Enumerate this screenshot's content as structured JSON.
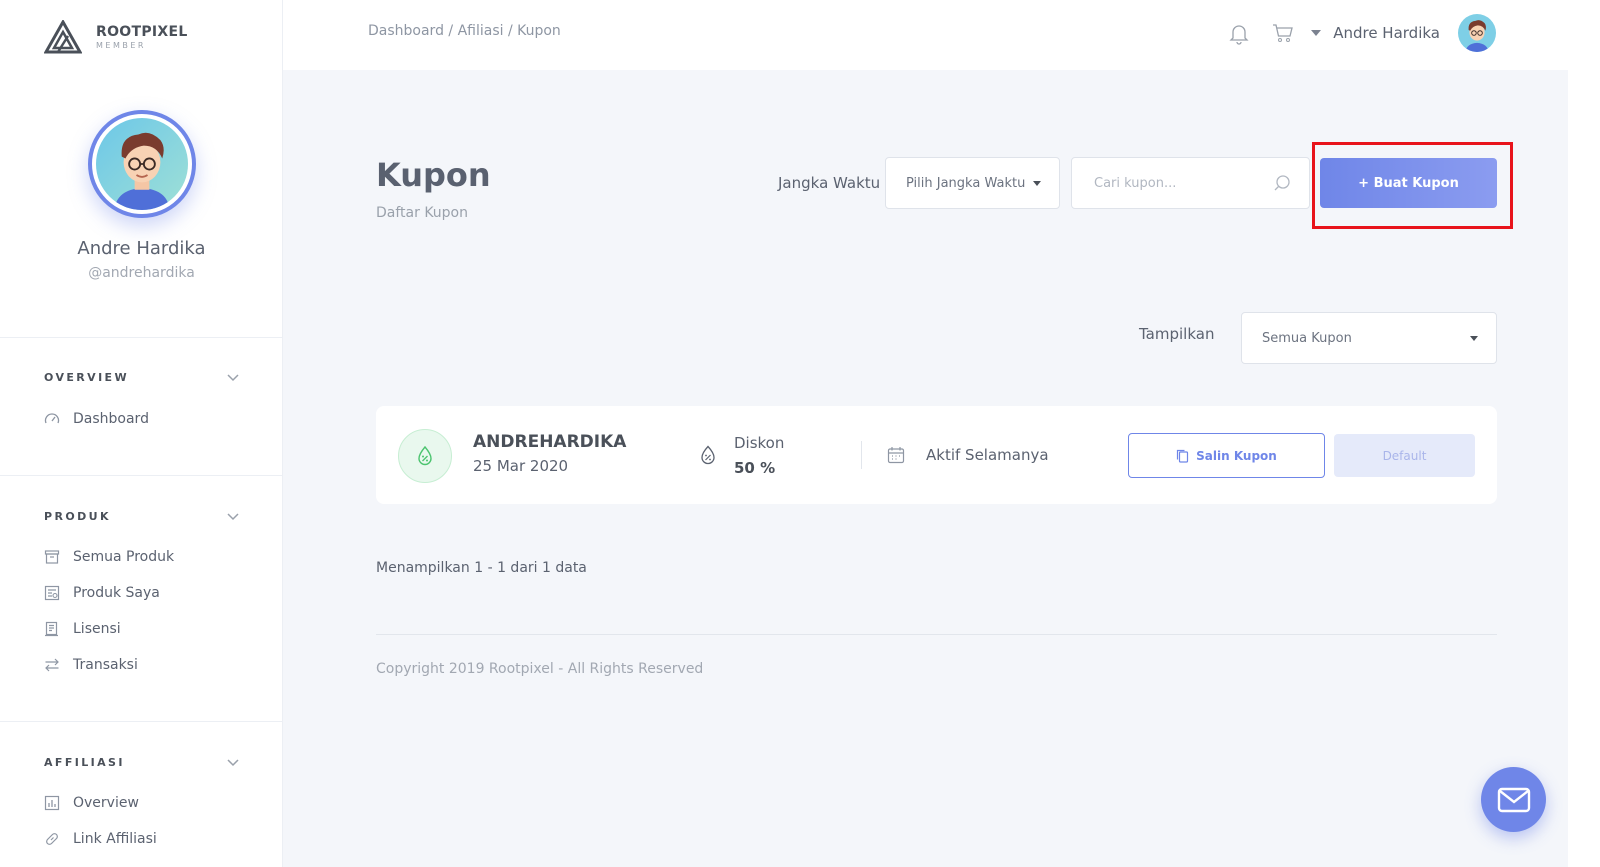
{
  "brand": {
    "name": "ROOTPIXEL",
    "sub": "MEMBER"
  },
  "profile": {
    "name": "Andre Hardika",
    "handle": "@andrehardika"
  },
  "sidebar": {
    "overview": {
      "title": "OVERVIEW",
      "items": [
        {
          "label": "Dashboard",
          "icon": "speedometer-icon"
        }
      ]
    },
    "produk": {
      "title": "PRODUK",
      "items": [
        {
          "label": "Semua Produk",
          "icon": "box-icon"
        },
        {
          "label": "Produk Saya",
          "icon": "product-list-icon"
        },
        {
          "label": "Lisensi",
          "icon": "license-icon"
        },
        {
          "label": "Transaksi",
          "icon": "transfer-icon"
        }
      ]
    },
    "affiliasi": {
      "title": "AFFILIASI",
      "items": [
        {
          "label": "Overview",
          "icon": "bar-chart-icon"
        },
        {
          "label": "Link Affiliasi",
          "icon": "link-icon"
        }
      ]
    }
  },
  "topbar": {
    "breadcrumb": "Dashboard / Afiliasi / Kupon",
    "user_name": "Andre Hardika"
  },
  "page": {
    "title": "Kupon",
    "subtitle": "Daftar Kupon"
  },
  "filters": {
    "period_label": "Jangka Waktu",
    "period_value": "Pilih Jangka Waktu",
    "search_placeholder": "Cari kupon...",
    "create_button": "+ Buat Kupon",
    "show_label": "Tampilkan",
    "show_value": "Semua Kupon"
  },
  "coupons": [
    {
      "code": "ANDREHARDIKA",
      "date": "25 Mar 2020",
      "discount_label": "Diskon",
      "discount_value": "50 %",
      "validity": "Aktif Selamanya",
      "copy_button": "Salin Kupon",
      "default_button": "Default"
    }
  ],
  "pagination": {
    "summary": "Menampilkan 1 - 1 dari 1 data"
  },
  "footer": {
    "copyright": "Copyright 2019 Rootpixel - All Rights Reserved"
  },
  "colors": {
    "accent": "#6f86e8",
    "highlight": "#e8131b",
    "success": "#4cc46f",
    "background": "#f4f6fa"
  }
}
